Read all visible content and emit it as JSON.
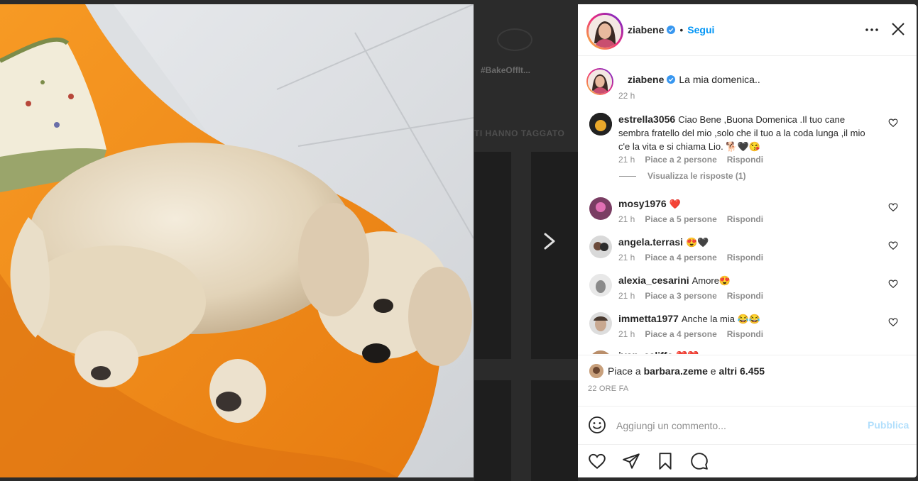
{
  "background": {
    "hashtag": "#BakeOffIt...",
    "tagged_label": "TI HANNO TAGGATO"
  },
  "post": {
    "author": "ziabene",
    "follow_label": "Segui",
    "dot": "•",
    "caption": "La mia domenica..",
    "caption_time": "22 h"
  },
  "comments": [
    {
      "user": "estrella3056",
      "text": "Ciao Bene ,Buona Domenica .Il tuo cane sembra fratello del mio ,solo che il tuo a la coda lunga ,il mio c'e la vita e si chiama Lio. 🐕🖤😘",
      "time": "21 h",
      "likes": "Piace a 2 persone",
      "reply": "Rispondi",
      "view_replies": "Visualizza le risposte (1)"
    },
    {
      "user": "mosy1976",
      "text": "❤️",
      "time": "21 h",
      "likes": "Piace a 5 persone",
      "reply": "Rispondi"
    },
    {
      "user": "angela.terrasi",
      "text": "😍🖤",
      "time": "21 h",
      "likes": "Piace a 4 persone",
      "reply": "Rispondi"
    },
    {
      "user": "alexia_cesarini",
      "text": "Amore😍",
      "time": "21 h",
      "likes": "Piace a 3 persone",
      "reply": "Rispondi"
    },
    {
      "user": "immetta1977",
      "text": "Anche la mia 😂😂",
      "time": "21 h",
      "likes": "Piace a 4 persone",
      "reply": "Rispondi"
    },
    {
      "user": "ivan_califfo",
      "text": "❤️❤️"
    }
  ],
  "likes_line": {
    "prefix": "Piace a",
    "user": "barbara.zeme",
    "middle": "e",
    "rest": "altri 6.455"
  },
  "time_ago": "22 ORE FA",
  "comment_box": {
    "placeholder": "Aggiungi un commento...",
    "publish_label": "Pubblica"
  },
  "colors": {
    "accent": "#0095f6",
    "publish_disabled": "#b2dffc",
    "muted": "#8e8e8e",
    "verified": "#3897f0",
    "like_red": "#ed4956"
  },
  "icons": [
    "more-options-icon",
    "close-icon",
    "heart-icon",
    "share-icon",
    "bookmark-icon",
    "comment-icon",
    "emoji-icon",
    "chevron-right-icon",
    "verified-icon"
  ]
}
